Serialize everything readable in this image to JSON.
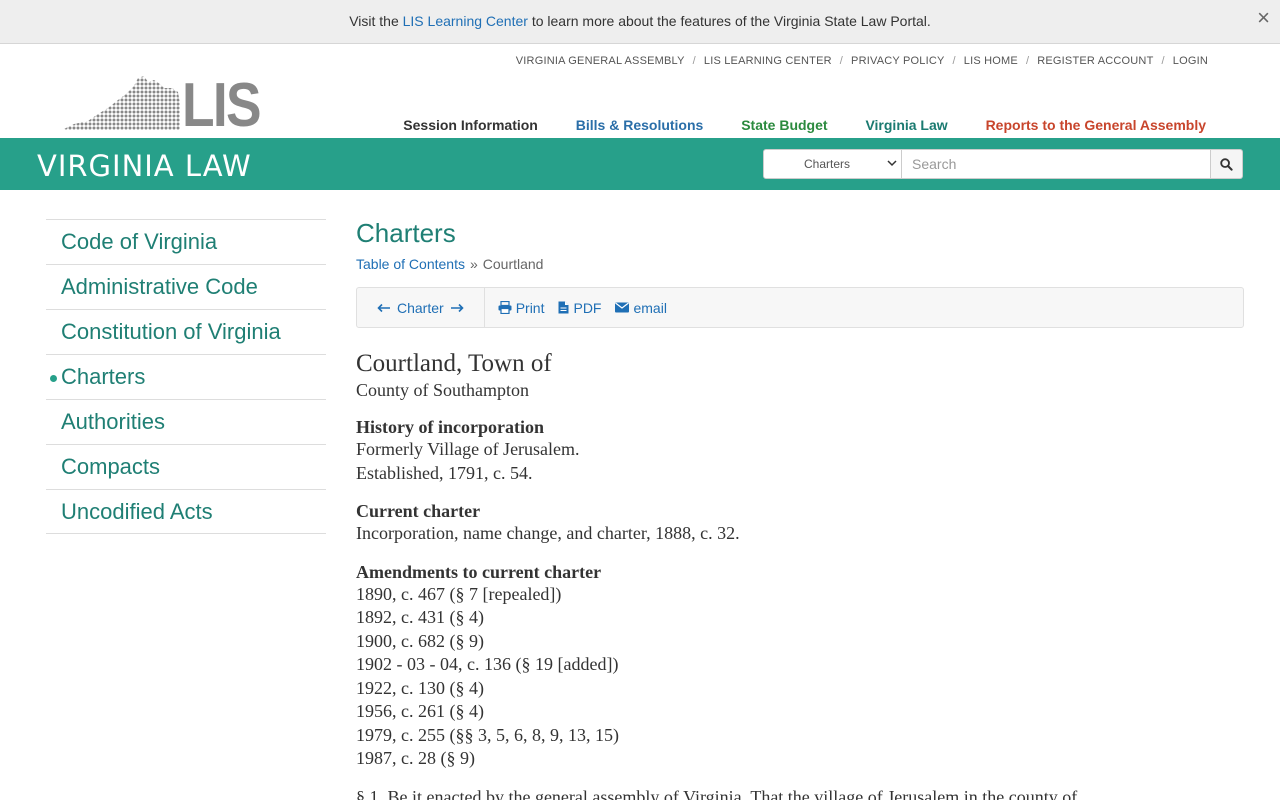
{
  "banner": {
    "prefix": "Visit the",
    "link": "LIS Learning Center",
    "suffix": "to learn more about the features of the Virginia State Law Portal.",
    "close": "×"
  },
  "utility_links": [
    "VIRGINIA GENERAL ASSEMBLY",
    "LIS LEARNING CENTER",
    "PRIVACY POLICY",
    "LIS HOME",
    "REGISTER ACCOUNT",
    "LOGIN"
  ],
  "logo": {
    "text": "LIS"
  },
  "main_nav": {
    "session": "Session Information",
    "bills": "Bills & Resolutions",
    "budget": "State Budget",
    "law": "Virginia Law",
    "reports": "Reports to the General Assembly"
  },
  "greenbar": {
    "title": "VIRGINIA LAW"
  },
  "search": {
    "selected": "Charters",
    "placeholder": "Search"
  },
  "sidebar": {
    "items": [
      {
        "label": "Code of Virginia"
      },
      {
        "label": "Administrative Code"
      },
      {
        "label": "Constitution of Virginia"
      },
      {
        "label": "Charters"
      },
      {
        "label": "Authorities"
      },
      {
        "label": "Compacts"
      },
      {
        "label": "Uncodified Acts"
      }
    ],
    "active": "Charters"
  },
  "content": {
    "title": "Charters",
    "breadcrumb": {
      "root": "Table of Contents",
      "sep": "»",
      "current": "Courtland"
    },
    "toolbar": {
      "charter": "Charter",
      "print": "Print",
      "pdf": "PDF",
      "email": "email"
    },
    "doc": {
      "title": "Courtland, Town of",
      "subtitle": "County of Southampton",
      "history_heading": "History of incorporation",
      "history": [
        "Formerly Village of Jerusalem.",
        "Established, 1791, c. 54."
      ],
      "current_heading": "Current charter",
      "current": [
        "Incorporation, name change, and charter, 1888, c. 32."
      ],
      "amend_heading": "Amendments to current charter",
      "amendments": [
        "1890, c. 467 (§ 7 [repealed])",
        "1892, c. 431 (§ 4)",
        "1900, c. 682 (§ 9)",
        "1902 - 03 - 04, c. 136 (§ 19 [added])",
        "1922, c. 130 (§ 4)",
        "1956, c. 261 (§ 4)",
        "1979, c. 255 (§§ 3, 5, 6, 8, 9, 13, 15)",
        "1987, c. 28 (§ 9)"
      ],
      "section1": "§ 1. Be it enacted by the general assembly of Virginia, That the village of Jerusalem in the county of"
    }
  },
  "colors": {
    "green": "#27a08a",
    "link": "#1f6fb5",
    "teal_text": "#1f7f74",
    "reports_red": "#c8452c"
  }
}
